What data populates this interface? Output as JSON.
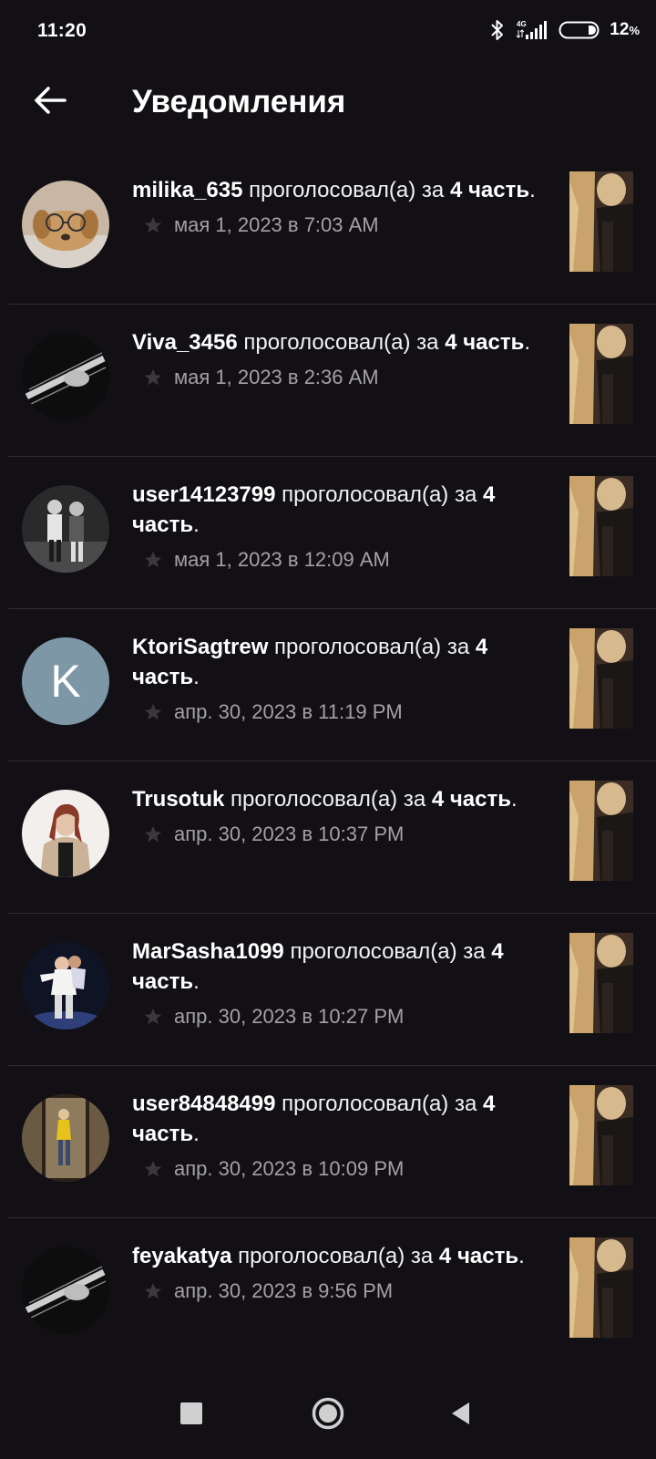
{
  "status_bar": {
    "time": "11:20",
    "network": "4G",
    "battery_value": "12",
    "battery_unit": "%",
    "icons": [
      "bluetooth-icon",
      "signal-icon",
      "battery-icon"
    ]
  },
  "header": {
    "back_icon": "arrow-left-icon",
    "title": "Уведомления"
  },
  "notifications": [
    {
      "user": "milika_635",
      "action": " проголосовал(а) за ",
      "part": "4 часть",
      "end": ".",
      "date": "мая 1, 2023 в 7:03 AM",
      "avatar": "photo"
    },
    {
      "user": "Viva_3456",
      "action": " проголосовал(а) за ",
      "part": "4 часть",
      "end": ".",
      "date": "мая 1, 2023 в 2:36 AM",
      "avatar": "photo"
    },
    {
      "user": "user14123799",
      "action": " проголосовал(а) за ",
      "part": "4 часть",
      "end": ".",
      "date": "мая 1, 2023 в 12:09 AM",
      "avatar": "photo"
    },
    {
      "user": "KtoriSagtrew",
      "action": " проголосовал(а) за ",
      "part": "4 часть",
      "end": ".",
      "date": "апр. 30, 2023 в 11:19 PM",
      "avatar_letter": "K"
    },
    {
      "user": "Trusotuk",
      "action": " проголосовал(а) за ",
      "part": "4 часть",
      "end": ".",
      "date": "апр. 30, 2023 в 10:37 PM",
      "avatar": "photo"
    },
    {
      "user": "MarSasha1099",
      "action": " проголосовал(а) за ",
      "part": "4 часть",
      "end": ".",
      "date": "апр. 30, 2023 в 10:27 PM",
      "avatar": "photo"
    },
    {
      "user": "user84848499",
      "action": " проголосовал(а) за ",
      "part": "4 часть",
      "end": ".",
      "date": "апр. 30, 2023 в 10:09 PM",
      "avatar": "photo"
    },
    {
      "user": "feyakatya",
      "action": " проголосовал(а) за ",
      "part": "4 часть",
      "end": ".",
      "date": "апр. 30, 2023 в 9:56 PM",
      "avatar": "photo"
    }
  ],
  "colors": {
    "background": "#121014",
    "divider": "#2e2c31",
    "meta_text": "#a3a1a6",
    "letter_avatar": "#7e97a7"
  },
  "nav_bar": {
    "icons": [
      "recents-square-icon",
      "home-circle-icon",
      "back-triangle-icon"
    ]
  }
}
